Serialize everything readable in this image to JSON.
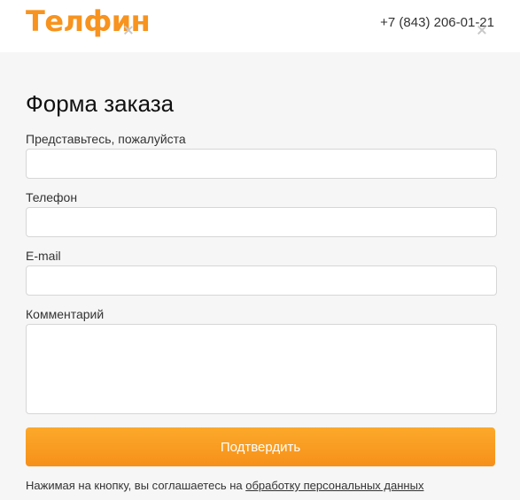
{
  "header": {
    "logo_text": "Телфин",
    "phone": "+7 (843) 206-01-21"
  },
  "form": {
    "title": "Форма заказа",
    "fields": {
      "name_label": "Представьтесь, пожалуйста",
      "name_value": "",
      "phone_label": "Телефон",
      "phone_value": "",
      "email_label": "E-mail",
      "email_value": "",
      "comment_label": "Комментарий",
      "comment_value": ""
    },
    "submit_label": "Подтвердить",
    "agreement_text": "Нажимая на кнопку, вы соглашаетесь на ",
    "agreement_link": "обработку персональных данных"
  },
  "colors": {
    "brand_orange": "#f7931e",
    "button_top": "#fca92a",
    "button_bottom": "#f6901a"
  },
  "icons": [
    "close-icon",
    "close-icon"
  ]
}
